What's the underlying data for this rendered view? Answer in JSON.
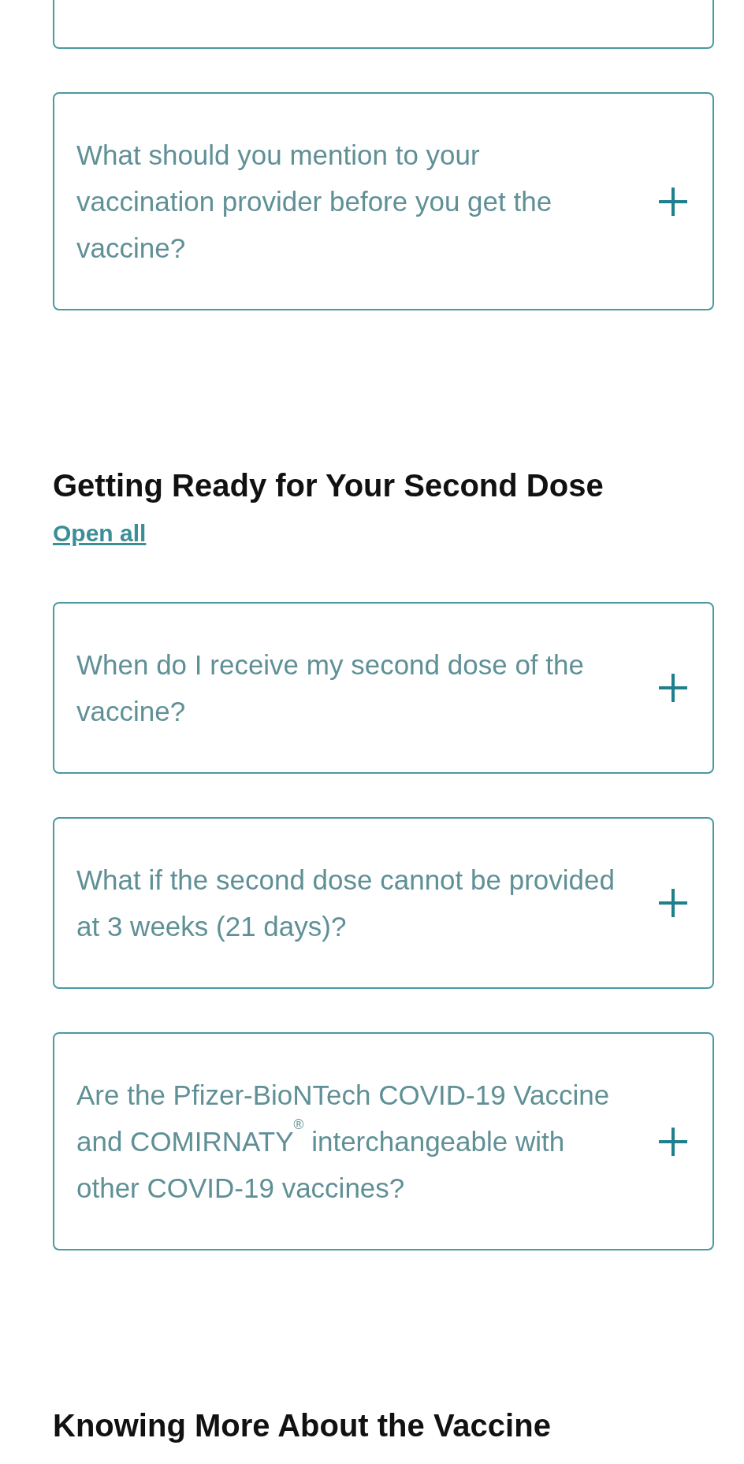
{
  "sections": [
    {
      "items": [
        {
          "kind": "clipped"
        },
        {
          "kind": "question",
          "question": "What should you mention to your vaccination provider before you get the vaccine?",
          "expanded": false
        }
      ]
    },
    {
      "heading": "Getting Ready for Your Second Dose",
      "link": "Open all",
      "items": [
        {
          "kind": "question",
          "question": "When do I receive my second dose of the vaccine?",
          "expanded": false
        },
        {
          "kind": "question",
          "question": "What if the second dose cannot be provided at 3 weeks (21 days)?",
          "expanded": false
        },
        {
          "kind": "question",
          "question": "Are the Pfizer-BioNTech COVID-19 Vaccine and COMIRNATY$^{®}$ interchangeable with other COVID-19 vaccines?",
          "expanded": false
        }
      ]
    },
    {
      "heading": "Knowing More About the Vaccine"
    }
  ]
}
